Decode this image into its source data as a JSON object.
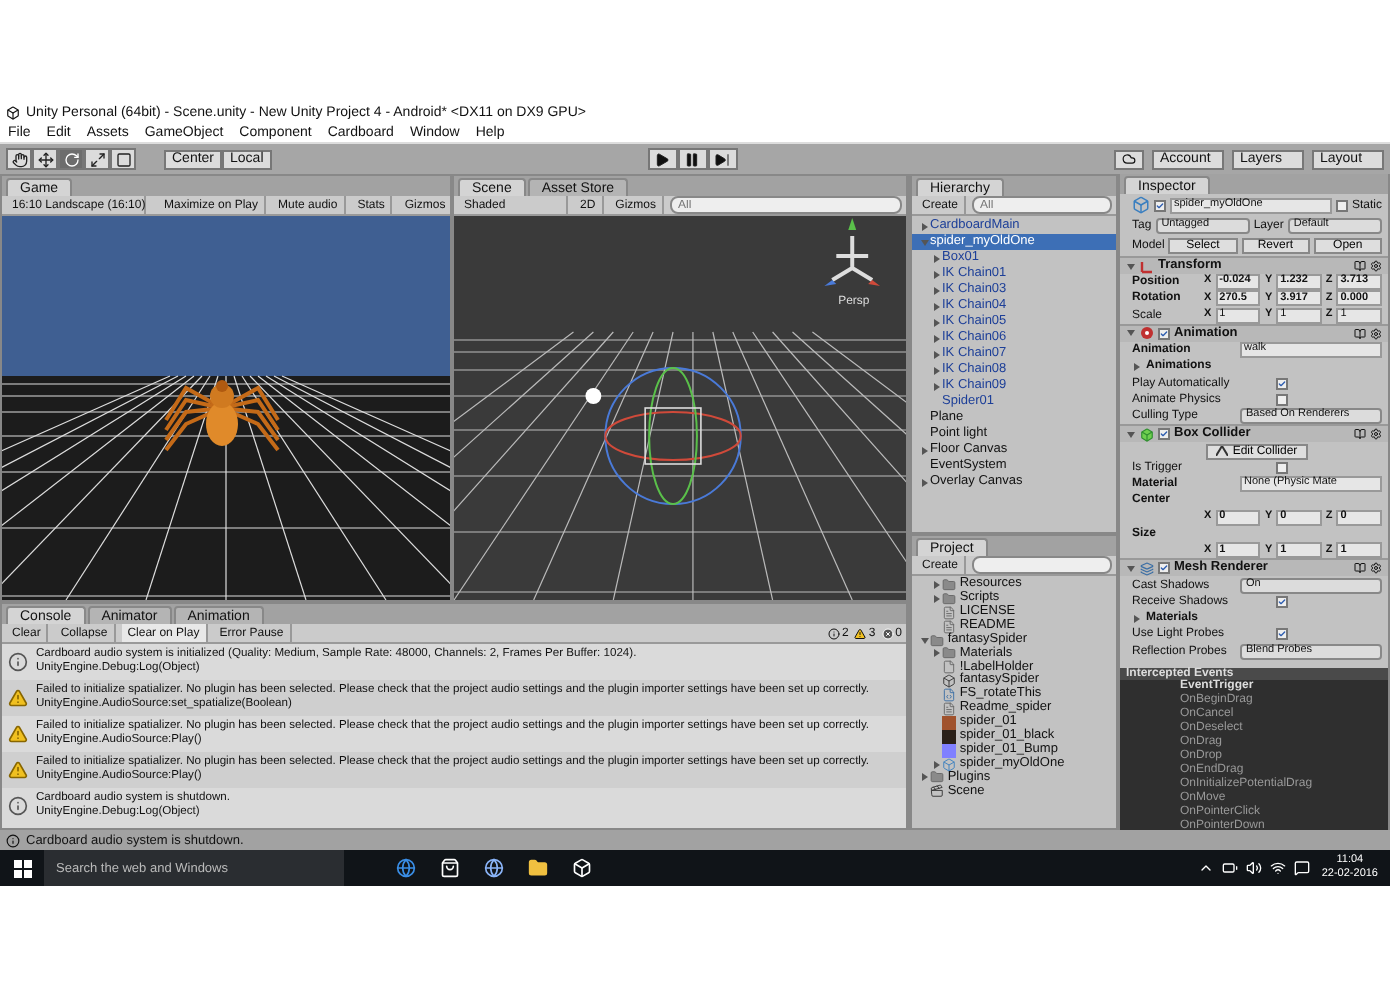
{
  "window": {
    "title": "Unity Personal (64bit) - Scene.unity - New Unity Project 4 - Android* <DX11 on DX9 GPU>"
  },
  "menu": [
    "File",
    "Edit",
    "Assets",
    "GameObject",
    "Component",
    "Cardboard",
    "Window",
    "Help"
  ],
  "toolbar": {
    "tools": [
      {
        "kind": "hand",
        "selected": false
      },
      {
        "kind": "move",
        "selected": false
      },
      {
        "kind": "rotate",
        "selected": true
      },
      {
        "kind": "scale",
        "selected": false
      },
      {
        "kind": "rect",
        "selected": false
      }
    ],
    "pivot": [
      "Center",
      "Local"
    ],
    "playback": [
      {
        "kind": "play",
        "selected": false
      },
      {
        "kind": "pause",
        "selected": false
      },
      {
        "kind": "step",
        "selected": false
      }
    ],
    "account": "Account",
    "layers": "Layers",
    "layout": "Layout"
  },
  "game": {
    "tab": "Game",
    "aspect": "16:10 Landscape (16:10)",
    "toggles": [
      "Maximize on Play",
      "Mute audio",
      "Stats",
      "Gizmos"
    ]
  },
  "scene": {
    "tabs": [
      {
        "label": "Scene",
        "selected": true
      },
      {
        "label": "Asset Store",
        "selected": false
      }
    ],
    "shading": "Shaded",
    "mode_2d": "2D",
    "gizmos": "Gizmos",
    "search_placeholder": "All",
    "view_label": "Persp"
  },
  "hierarchy": {
    "tab": "Hierarchy",
    "create": "Create",
    "search_placeholder": "All",
    "items": [
      {
        "label": "CardboardMain",
        "kind": "group",
        "expanded": false,
        "prefab": true,
        "selected": false
      },
      {
        "label": "spider_myOldOne",
        "kind": "group",
        "expanded": true,
        "prefab": true,
        "selected": true,
        "children": [
          {
            "label": "Box01",
            "kind": "group",
            "expanded": false,
            "prefab": true,
            "selected": false
          },
          {
            "label": "IK Chain01",
            "kind": "group",
            "expanded": false,
            "prefab": true,
            "selected": false
          },
          {
            "label": "IK Chain03",
            "kind": "group",
            "expanded": false,
            "prefab": true,
            "selected": false
          },
          {
            "label": "IK Chain04",
            "kind": "group",
            "expanded": false,
            "prefab": true,
            "selected": false
          },
          {
            "label": "IK Chain05",
            "kind": "group",
            "expanded": false,
            "prefab": true,
            "selected": false
          },
          {
            "label": "IK Chain06",
            "kind": "group",
            "expanded": false,
            "prefab": true,
            "selected": false
          },
          {
            "label": "IK Chain07",
            "kind": "group",
            "expanded": false,
            "prefab": true,
            "selected": false
          },
          {
            "label": "IK Chain08",
            "kind": "group",
            "expanded": false,
            "prefab": true,
            "selected": false
          },
          {
            "label": "IK Chain09",
            "kind": "group",
            "expanded": false,
            "prefab": true,
            "selected": false
          },
          {
            "label": "Spider01",
            "kind": "leaf",
            "prefab": true,
            "selected": false
          }
        ]
      },
      {
        "label": "Plane",
        "kind": "leaf",
        "prefab": false,
        "selected": false
      },
      {
        "label": "Point light",
        "kind": "leaf",
        "prefab": false,
        "selected": false
      },
      {
        "label": "Floor Canvas",
        "kind": "group",
        "expanded": false,
        "prefab": false,
        "selected": false
      },
      {
        "label": "EventSystem",
        "kind": "leaf",
        "prefab": false,
        "selected": false
      },
      {
        "label": "Overlay Canvas",
        "kind": "group",
        "expanded": false,
        "prefab": false,
        "selected": false
      }
    ]
  },
  "inspector": {
    "tab": "Inspector",
    "object": {
      "active": true,
      "name": "spider_myOldOne",
      "static_label": "Static",
      "static": false
    },
    "tag_label": "Tag",
    "tag": "Untagged",
    "layer_label": "Layer",
    "layer": "Default",
    "model_label": "Model",
    "model_buttons": [
      "Select",
      "Revert",
      "Open"
    ],
    "components": [
      {
        "kind": "transform",
        "title": "Transform",
        "rows": [
          {
            "kind": "vector",
            "label": "Position",
            "modified": true,
            "values": [
              [
                "X",
                "-0.024"
              ],
              [
                "Y",
                "1.232"
              ],
              [
                "Z",
                "3.713"
              ]
            ]
          },
          {
            "kind": "vector",
            "label": "Rotation",
            "modified": true,
            "values": [
              [
                "X",
                "270.5"
              ],
              [
                "Y",
                "3.917"
              ],
              [
                "Z",
                "0.000"
              ]
            ]
          },
          {
            "kind": "vector",
            "label": "Scale",
            "modified": false,
            "values": [
              [
                "X",
                "1"
              ],
              [
                "Y",
                "1"
              ],
              [
                "Z",
                "1"
              ]
            ]
          }
        ]
      },
      {
        "kind": "behaviour",
        "title": "Animation",
        "enabled": true,
        "rows": [
          {
            "kind": "object",
            "label": "Animation",
            "value": "walk"
          },
          {
            "kind": "foldout",
            "label": "Animations"
          },
          {
            "kind": "checkbox",
            "label": "Play Automatically",
            "checked": true
          },
          {
            "kind": "checkbox",
            "label": "Animate Physics",
            "checked": false
          },
          {
            "kind": "dropdown",
            "label": "Culling Type",
            "value": "Based On Renderers"
          }
        ]
      },
      {
        "kind": "behaviour",
        "title": "Box Collider",
        "enabled": true,
        "rows": [
          {
            "kind": "button",
            "label": "Edit Collider"
          },
          {
            "kind": "checkbox",
            "label": "Is Trigger",
            "checked": false
          },
          {
            "kind": "object",
            "label": "Material",
            "value": "None (Physic Mate"
          },
          {
            "kind": "heading",
            "label": "Center"
          },
          {
            "kind": "vector",
            "label": "",
            "modified": true,
            "values": [
              [
                "X",
                "0"
              ],
              [
                "Y",
                "0"
              ],
              [
                "Z",
                "0"
              ]
            ]
          },
          {
            "kind": "heading",
            "label": "Size"
          },
          {
            "kind": "vector",
            "label": "",
            "modified": true,
            "values": [
              [
                "X",
                "1"
              ],
              [
                "Y",
                "1"
              ],
              [
                "Z",
                "1"
              ]
            ]
          }
        ]
      },
      {
        "kind": "behaviour",
        "title": "Mesh Renderer",
        "enabled": true,
        "rows": [
          {
            "kind": "dropdown",
            "label": "Cast Shadows",
            "value": "On"
          },
          {
            "kind": "checkbox",
            "label": "Receive Shadows",
            "checked": true
          },
          {
            "kind": "foldout",
            "label": "Materials"
          },
          {
            "kind": "checkbox",
            "label": "Use Light Probes",
            "checked": true
          },
          {
            "kind": "dropdown",
            "label": "Reflection Probes",
            "value": "Blend Probes"
          }
        ]
      }
    ]
  },
  "events": {
    "title": "Intercepted Events",
    "items": [
      {
        "kind": "header",
        "label": "EventTrigger"
      },
      {
        "kind": "event",
        "label": "OnBeginDrag"
      },
      {
        "kind": "event",
        "label": "OnCancel"
      },
      {
        "kind": "event",
        "label": "OnDeselect"
      },
      {
        "kind": "event",
        "label": "OnDrag"
      },
      {
        "kind": "event",
        "label": "OnDrop"
      },
      {
        "kind": "event",
        "label": "OnEndDrag"
      },
      {
        "kind": "event",
        "label": "OnInitializePotentialDrag"
      },
      {
        "kind": "event",
        "label": "OnMove"
      },
      {
        "kind": "event",
        "label": "OnPointerClick"
      },
      {
        "kind": "event",
        "label": "OnPointerDown"
      }
    ]
  },
  "console": {
    "tabs": [
      {
        "label": "Console",
        "selected": true
      },
      {
        "label": "Animator",
        "selected": false
      },
      {
        "label": "Animation",
        "selected": false
      }
    ],
    "buttons": [
      {
        "label": "Clear",
        "selected": false
      },
      {
        "label": "Collapse",
        "selected": false
      },
      {
        "label": "Clear on Play",
        "selected": true
      },
      {
        "label": "Error Pause",
        "selected": false
      }
    ],
    "counts": [
      {
        "kind": "info",
        "count": "2"
      },
      {
        "kind": "warning",
        "count": "3"
      },
      {
        "kind": "error",
        "count": "0"
      }
    ],
    "messages": [
      {
        "kind": "info",
        "text": "Cardboard audio system is initialized (Quality: Medium, Sample Rate: 48000, Channels: 2, Frames Per Buffer: 1024).",
        "trace": "UnityEngine.Debug:Log(Object)"
      },
      {
        "kind": "warning",
        "text": "Failed to initialize spatializer. No plugin has been selected. Please check that the project audio settings and the plugin importer settings have been set up correctly.",
        "trace": "UnityEngine.AudioSource:set_spatialize(Boolean)"
      },
      {
        "kind": "warning",
        "text": "Failed to initialize spatializer. No plugin has been selected. Please check that the project audio settings and the plugin importer settings have been set up correctly.",
        "trace": "UnityEngine.AudioSource:Play()"
      },
      {
        "kind": "warning",
        "text": "Failed to initialize spatializer. No plugin has been selected. Please check that the project audio settings and the plugin importer settings have been set up correctly.",
        "trace": "UnityEngine.AudioSource:Play()"
      },
      {
        "kind": "info",
        "text": "Cardboard audio system is shutdown.",
        "trace": "UnityEngine.Debug:Log(Object)"
      }
    ]
  },
  "project": {
    "tab": "Project",
    "create": "Create",
    "scrolled_parent_children": [
      {
        "kind": "folder",
        "label": "Resources",
        "expanded": false
      },
      {
        "kind": "folder",
        "label": "Scripts",
        "expanded": false
      },
      {
        "kind": "text",
        "label": "LICENSE"
      },
      {
        "kind": "text",
        "label": "README"
      }
    ],
    "items": [
      {
        "kind": "folder",
        "label": "fantasySpider",
        "expanded": true,
        "children": [
          {
            "kind": "folder",
            "label": "Materials",
            "expanded": false
          },
          {
            "kind": "file",
            "label": "!LabelHolder"
          },
          {
            "kind": "model",
            "label": "fantasySpider"
          },
          {
            "kind": "script",
            "label": "FS_rotateThis"
          },
          {
            "kind": "text",
            "label": "Readme_spider"
          },
          {
            "kind": "texture",
            "label": "spider_01",
            "color": "#a0522d"
          },
          {
            "kind": "texture",
            "label": "spider_01_black",
            "color": "#2a2018"
          },
          {
            "kind": "texture",
            "label": "spider_01_Bump",
            "color": "#8080ff"
          },
          {
            "kind": "prefab",
            "label": "spider_myOldOne",
            "expanded": false
          }
        ]
      },
      {
        "kind": "folder",
        "label": "Plugins",
        "expanded": false
      },
      {
        "kind": "scene",
        "label": "Scene"
      }
    ]
  },
  "status_bar": "Cardboard audio system is shutdown.",
  "taskbar": {
    "search_placeholder": "Search the web and Windows",
    "time": "11:04",
    "date": "22-02-2016"
  }
}
